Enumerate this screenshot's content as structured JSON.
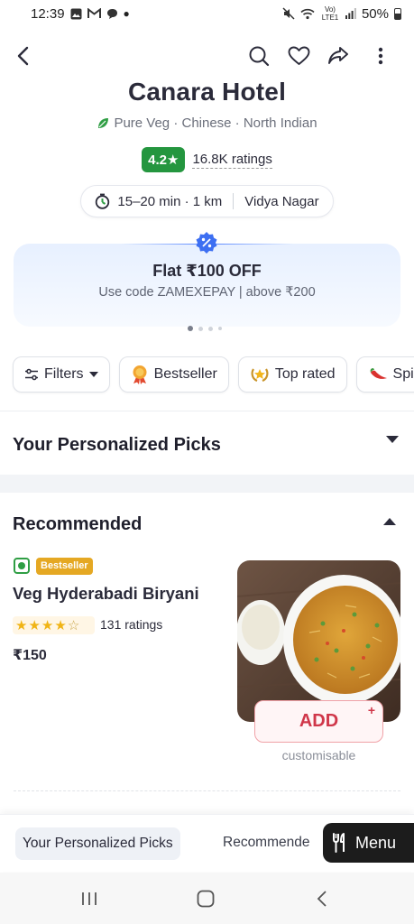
{
  "status_bar": {
    "time": "12:39",
    "signal_text": "Vo) LTE1",
    "battery": "50%"
  },
  "nav": {
    "icons": [
      "back-arrow-icon",
      "search-icon",
      "heart-icon",
      "share-icon",
      "more-vertical-icon"
    ]
  },
  "restaurant": {
    "name": "Canara Hotel",
    "cuisines": "Pure Veg · Chinese · North Indian",
    "rating": "4.2",
    "rating_star": "★",
    "ratings_count": "16.8K ratings",
    "delivery_time": "15–20 min · 1 km",
    "location": "Vidya Nagar"
  },
  "offer": {
    "title": "Flat ₹100 OFF",
    "subtitle": "Use code ZAMEXEPAY | above ₹200",
    "slide_count": 4,
    "active_slide": 1
  },
  "filters": [
    {
      "label": "Filters",
      "icon": "sliders-icon"
    },
    {
      "label": "Bestseller",
      "icon": "medal-icon"
    },
    {
      "label": "Top rated",
      "icon": "laurel-icon"
    },
    {
      "label": "Spi",
      "icon": "chili-icon"
    }
  ],
  "sections": {
    "personalized": "Your Personalized Picks",
    "recommended": "Recommended"
  },
  "dish": {
    "tag": "Bestseller",
    "name": "Veg Hyderabadi Biryani",
    "stars": 4,
    "ratings": "131 ratings",
    "price": "₹150",
    "add_label": "ADD",
    "add_plus": "+",
    "note": "customisable"
  },
  "bottom_bar": {
    "tab_active": "Your Personalized Picks",
    "tab_next": "Recommende",
    "menu_label": "Menu"
  },
  "colors": {
    "rating_green": "#24963f",
    "add_red": "#d0374a",
    "offer_blue": "#4f80ff",
    "bestseller_orange": "#e5a823"
  }
}
